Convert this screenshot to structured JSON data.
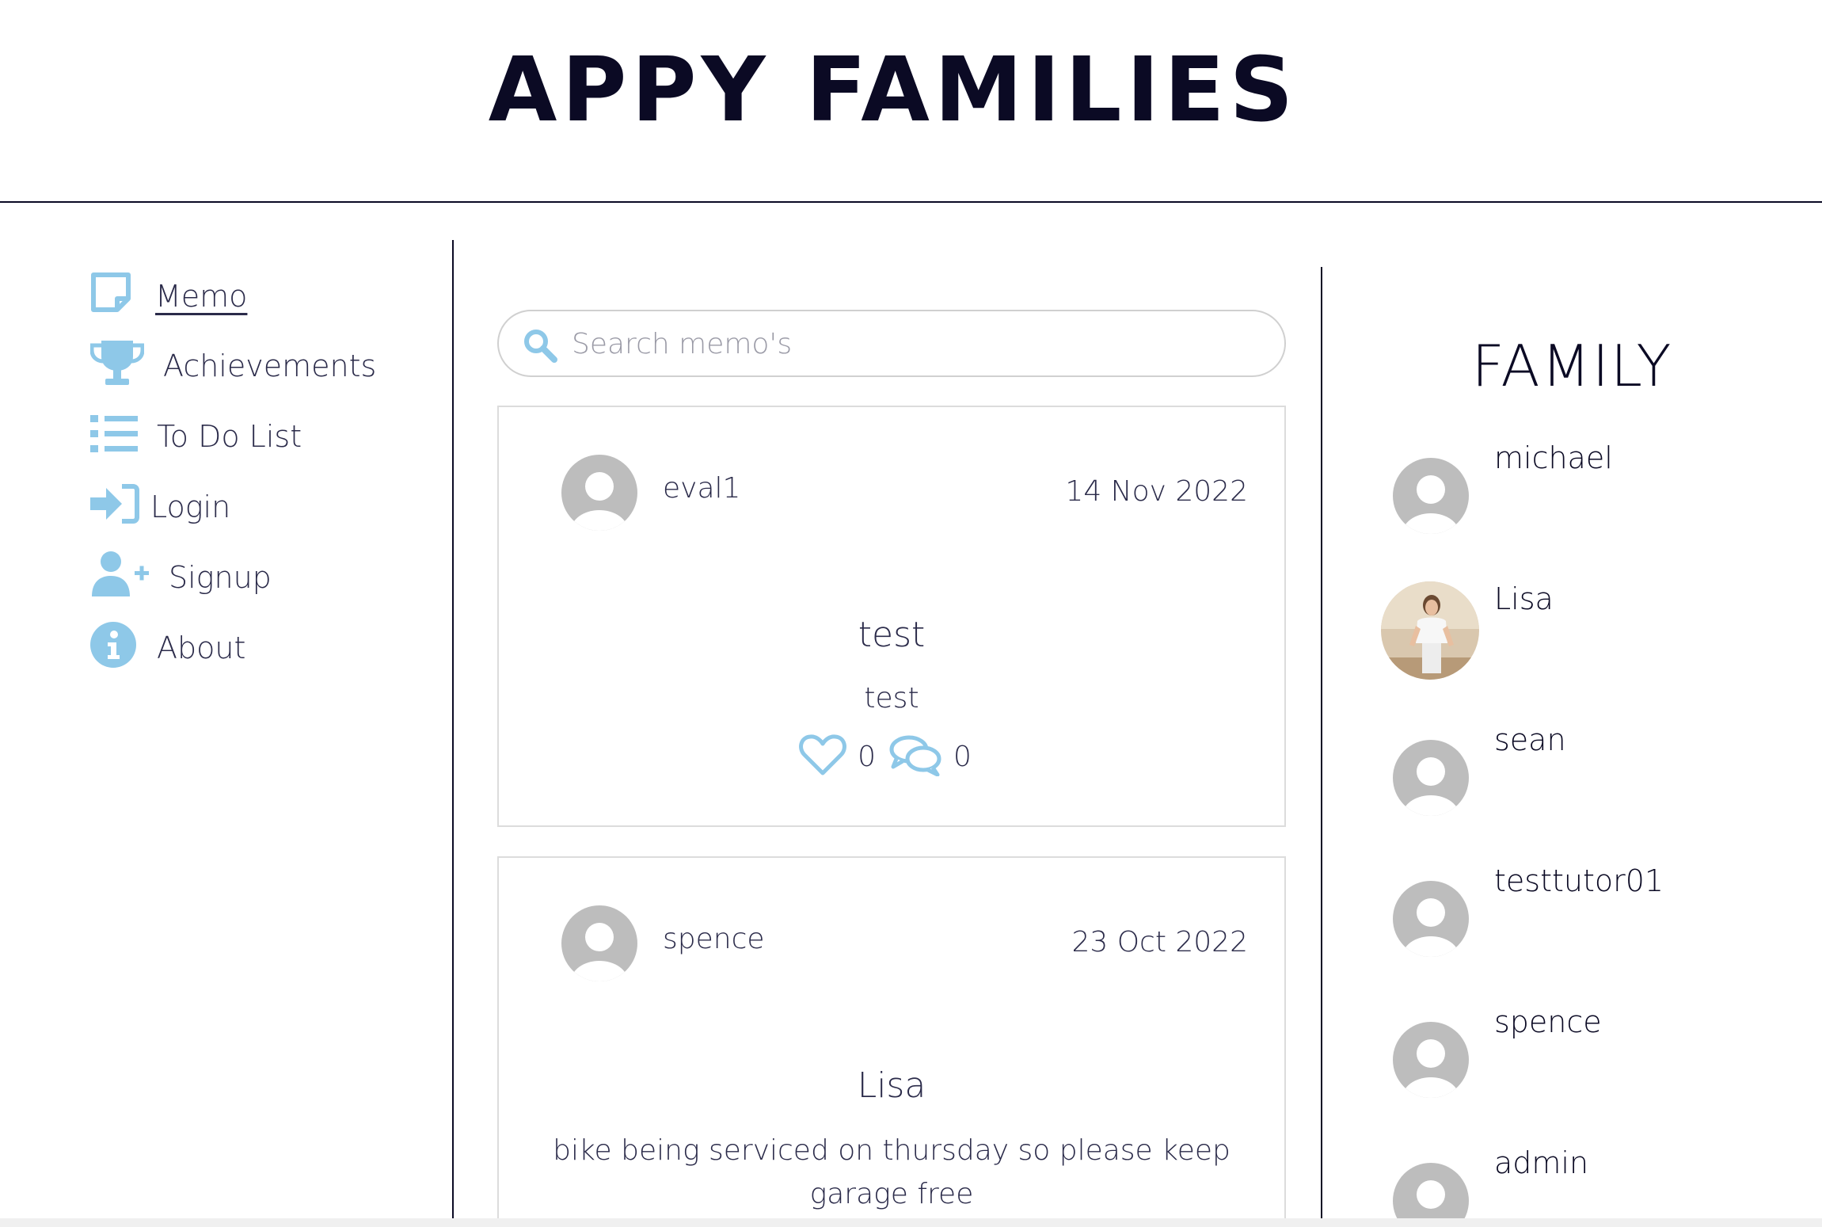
{
  "header": {
    "title": "APPY FAMILIES"
  },
  "nav": {
    "memo": "Memo",
    "achievements": "Achievements",
    "todo": "To Do List",
    "login": "Login",
    "signup": "Signup",
    "about": "About"
  },
  "search": {
    "placeholder": "Search memo's",
    "value": ""
  },
  "memos": [
    {
      "author": "eval1",
      "date": "14 Nov 2022",
      "title": "test",
      "body": "test",
      "likes": "0",
      "comments": "0"
    },
    {
      "author": "spence",
      "date": "23 Oct 2022",
      "title": "Lisa",
      "body": "bike being serviced on thursday so please keep garage free"
    }
  ],
  "family": {
    "title": "FAMILY",
    "members": [
      {
        "name": "michael"
      },
      {
        "name": "Lisa"
      },
      {
        "name": "sean"
      },
      {
        "name": "testtutor01"
      },
      {
        "name": "spence"
      },
      {
        "name": "admin"
      }
    ]
  },
  "colors": {
    "accent": "#8ec8e8",
    "ink": "#0b0a24",
    "text": "#2b2b4a",
    "avatar": "#bdbdbd"
  },
  "icons": [
    "memo-icon",
    "trophy-icon",
    "list-icon",
    "login-icon",
    "user-plus-icon",
    "info-icon",
    "search-icon",
    "heart-icon",
    "comments-icon",
    "default-avatar-icon"
  ]
}
